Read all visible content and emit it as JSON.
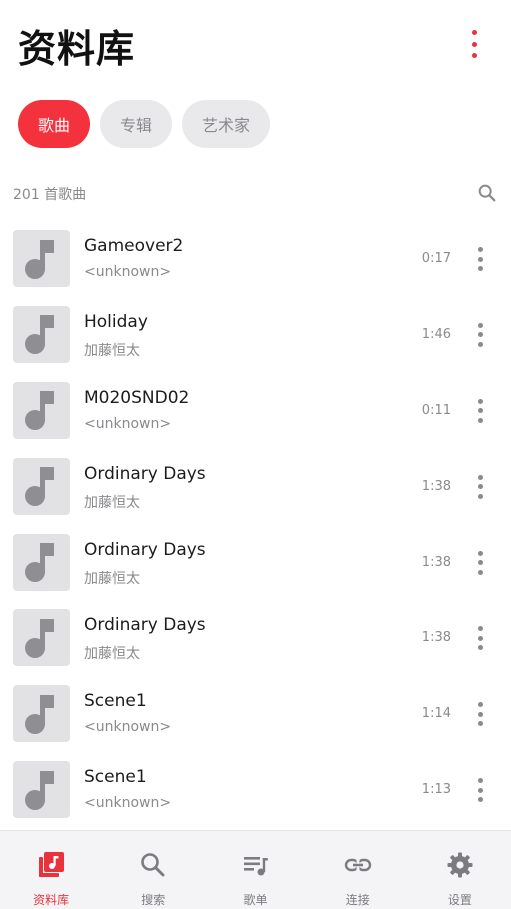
{
  "header": {
    "title": "资料库"
  },
  "chips": [
    {
      "label": "歌曲",
      "active": true
    },
    {
      "label": "专辑",
      "active": false
    },
    {
      "label": "艺术家",
      "active": false
    }
  ],
  "list_header": {
    "count_text": "201 首歌曲"
  },
  "songs": [
    {
      "title": "Gameover2",
      "artist": "<unknown>",
      "duration": "0:17"
    },
    {
      "title": "Holiday",
      "artist": "加藤恒太",
      "duration": "1:46"
    },
    {
      "title": "M020SND02",
      "artist": "<unknown>",
      "duration": "0:11"
    },
    {
      "title": "Ordinary Days",
      "artist": "加藤恒太",
      "duration": "1:38"
    },
    {
      "title": "Ordinary Days",
      "artist": "加藤恒太",
      "duration": "1:38"
    },
    {
      "title": "Ordinary Days",
      "artist": "加藤恒太",
      "duration": "1:38"
    },
    {
      "title": "Scene1",
      "artist": "<unknown>",
      "duration": "1:14"
    },
    {
      "title": "Scene1",
      "artist": "<unknown>",
      "duration": "1:13"
    }
  ],
  "tabbar": {
    "items": [
      {
        "label": "资料库",
        "icon": "library-music-icon",
        "active": true
      },
      {
        "label": "搜索",
        "icon": "search-icon",
        "active": false
      },
      {
        "label": "歌单",
        "icon": "playlist-icon",
        "active": false
      },
      {
        "label": "连接",
        "icon": "link-icon",
        "active": false
      },
      {
        "label": "设置",
        "icon": "settings-icon",
        "active": false
      }
    ]
  },
  "colors": {
    "accent": "#e8323c",
    "chip_inactive_bg": "#e9e9ec",
    "secondary_text": "#8a8a8e",
    "thumb_bg": "#e2e2e5",
    "tabbar_bg": "#f4f4f6"
  }
}
